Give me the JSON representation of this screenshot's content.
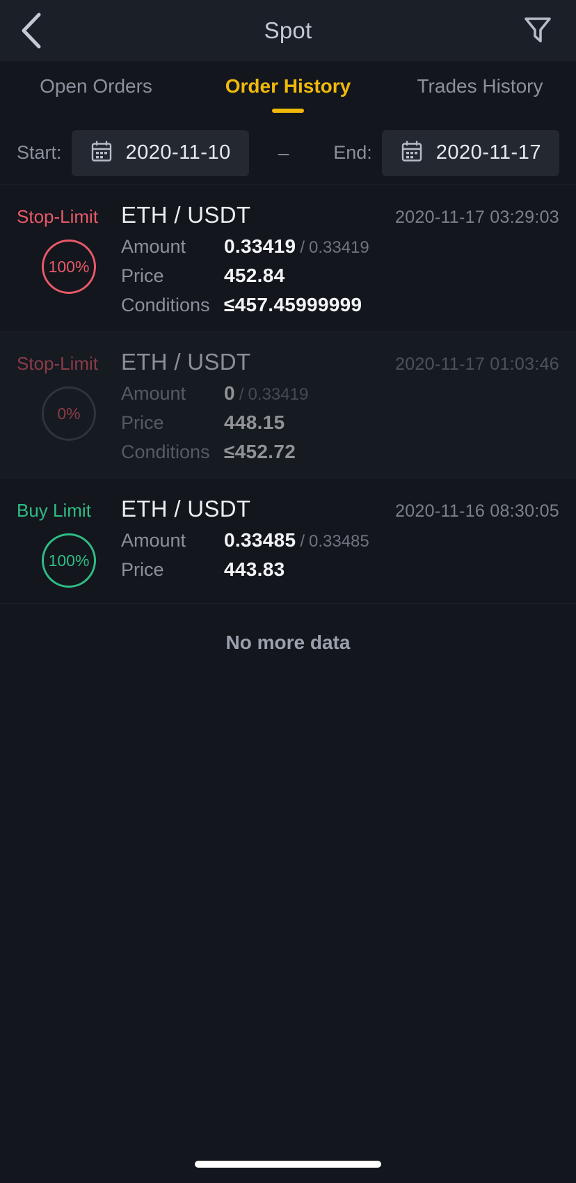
{
  "topbar": {
    "back_icon": "chevron-left-icon",
    "title": "Spot",
    "filter_icon": "filter-funnel-icon"
  },
  "tabs": [
    {
      "label": "Open Orders",
      "active": false
    },
    {
      "label": "Order History",
      "active": true
    },
    {
      "label": "Trades History",
      "active": false
    }
  ],
  "date_filter": {
    "start_label": "Start:",
    "start_value": "2020-11-10",
    "separator": "–",
    "end_label": "End:",
    "end_value": "2020-11-17",
    "calendar_icon": "calendar-icon"
  },
  "orders": [
    {
      "type": "Stop-Limit",
      "side": "sell",
      "pair": "ETH / USDT",
      "time": "2020-11-17 03:29:03",
      "fill_percent": "100%",
      "amount_label": "Amount",
      "amount_filled": "0.33419",
      "amount_sep": "/",
      "amount_total": "0.33419",
      "price_label": "Price",
      "price": "452.84",
      "conditions_label": "Conditions",
      "conditions": "≤457.45999999"
    },
    {
      "type": "Stop-Limit",
      "side": "sell",
      "pair": "ETH / USDT",
      "time": "2020-11-17 01:03:46",
      "fill_percent": "0%",
      "amount_label": "Amount",
      "amount_filled": "0",
      "amount_sep": "/",
      "amount_total": "0.33419",
      "price_label": "Price",
      "price": "448.15",
      "conditions_label": "Conditions",
      "conditions": "≤452.72"
    },
    {
      "type": "Buy Limit",
      "side": "buy",
      "pair": "ETH / USDT",
      "time": "2020-11-16 08:30:05",
      "fill_percent": "100%",
      "amount_label": "Amount",
      "amount_filled": "0.33485",
      "amount_sep": "/",
      "amount_total": "0.33485",
      "price_label": "Price",
      "price": "443.83",
      "conditions_label": "",
      "conditions": ""
    }
  ],
  "footer": {
    "no_more_data": "No more data"
  },
  "colors": {
    "accent": "#f0b90b",
    "sell": "#e8596a",
    "buy": "#2ebd85",
    "bg": "#13161c",
    "bg_alt": "#1a1e26",
    "topbar_bg": "#1b1f27"
  }
}
